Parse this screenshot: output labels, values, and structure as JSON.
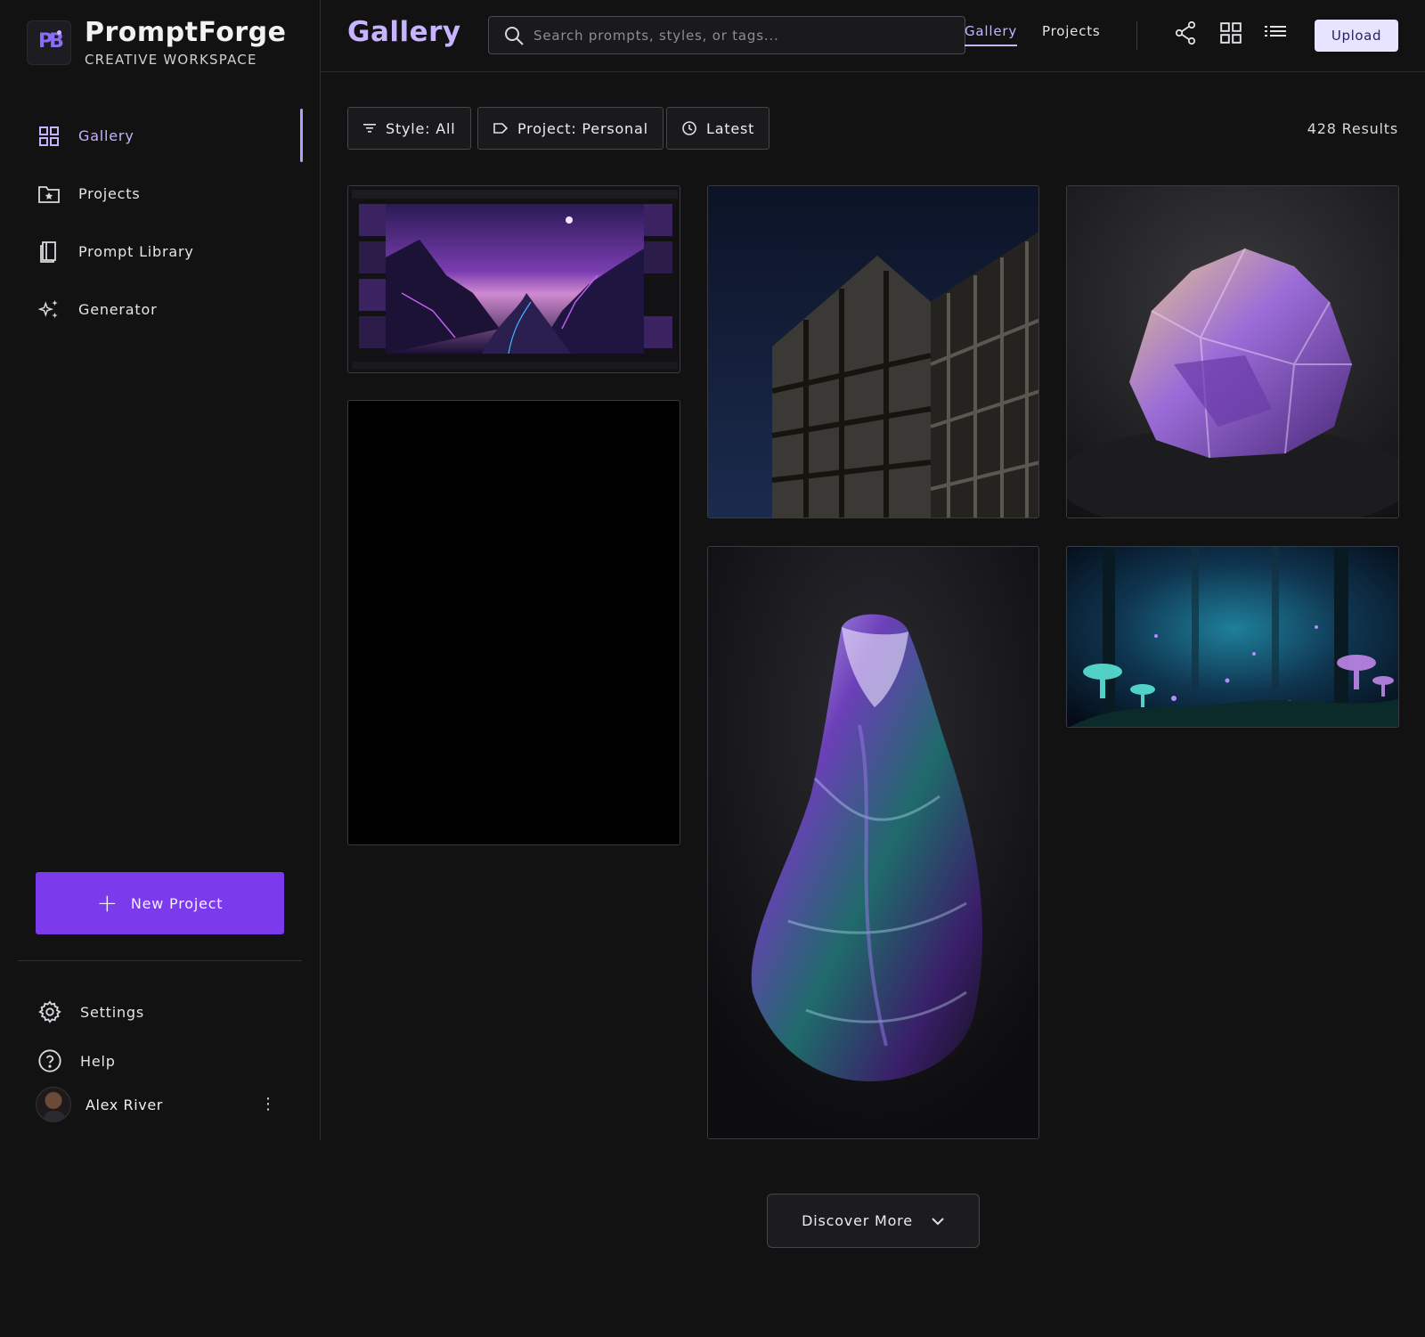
{
  "brand": {
    "name": "PromptForge",
    "subtitle": "CREATIVE WORKSPACE"
  },
  "sidebar": {
    "items": [
      {
        "label": "Gallery",
        "icon": "grid-icon",
        "active": true
      },
      {
        "label": "Projects",
        "icon": "folder-star-icon",
        "active": false
      },
      {
        "label": "Prompt Library",
        "icon": "book-icon",
        "active": false
      },
      {
        "label": "Generator",
        "icon": "sparkles-icon",
        "active": false
      }
    ],
    "new_project_label": "New Project",
    "settings_label": "Settings",
    "help_label": "Help",
    "user_name": "Alex River"
  },
  "header": {
    "title": "Gallery",
    "search_placeholder": "Search prompts, styles, or tags...",
    "links": [
      {
        "label": "Gallery",
        "active": true
      },
      {
        "label": "Projects",
        "active": false
      }
    ],
    "icons": [
      "share-icon",
      "grid-view-icon",
      "list-view-icon"
    ],
    "upload_label": "Upload"
  },
  "filters": {
    "style": "Style: All",
    "project": "Project: Personal",
    "sort": "Latest",
    "results": "428 Results"
  },
  "discover_label": "Discover More",
  "colors": {
    "accent": "#7c3aed",
    "accent_light": "#c7b3ff",
    "background": "#121212",
    "upload_bg": "#e6e4ff"
  }
}
